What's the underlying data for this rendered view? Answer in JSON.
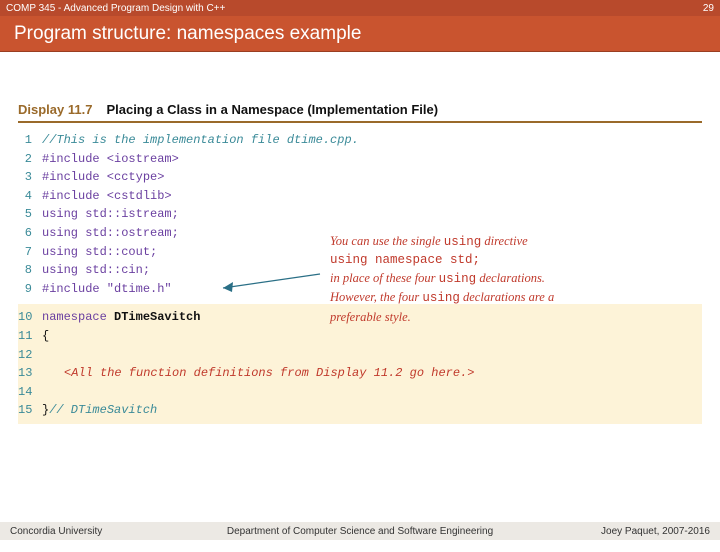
{
  "topbar": {
    "course": "COMP 345 - Advanced Program Design with C++",
    "slideNo": "29"
  },
  "title": "Program structure: namespaces example",
  "display": {
    "label": "Display 11.7",
    "title": "Placing a Class in a Namespace (Implementation File)"
  },
  "code1": [
    {
      "n": "1",
      "cls": "c-comment",
      "t": "//This is the implementation file dtime.cpp."
    },
    {
      "n": "2",
      "cls": "c-stmt",
      "t": "#include <iostream>"
    },
    {
      "n": "3",
      "cls": "c-stmt",
      "t": "#include <cctype>"
    },
    {
      "n": "4",
      "cls": "c-stmt",
      "t": "#include <cstdlib>"
    },
    {
      "n": "5",
      "cls": "c-stmt",
      "t": "using std::istream;"
    },
    {
      "n": "6",
      "cls": "c-stmt",
      "t": "using std::ostream;"
    },
    {
      "n": "7",
      "cls": "c-stmt",
      "t": "using std::cout;"
    },
    {
      "n": "8",
      "cls": "c-stmt",
      "t": "using std::cin;"
    },
    {
      "n": "9",
      "cls": "c-stmt",
      "t": "#include \"dtime.h\""
    }
  ],
  "code2": {
    "n10": "10",
    "ns": "namespace",
    "name": "DTimeSavitch",
    "n11": "11",
    "open": "{",
    "n12": "12",
    "n13": "13",
    "templ": "<All the function definitions from Display 11.2 go here.>",
    "n14": "14",
    "n15": "15",
    "close": "}",
    "end": "// DTimeSavitch"
  },
  "annotation": {
    "l1a": "You can use the single ",
    "kw1": "using",
    "l1b": " directive",
    "l2": "using namespace std;",
    "l3a": "in place of these four ",
    "kw3": "using",
    "l3b": " declarations.",
    "l4a": "However, the four ",
    "kw4": "using",
    "l4b": " declarations are a",
    "l5": "preferable style."
  },
  "footer": {
    "left": "Concordia University",
    "mid": "Department of Computer Science and Software Engineering",
    "right": "Joey Paquet, 2007-2016"
  }
}
